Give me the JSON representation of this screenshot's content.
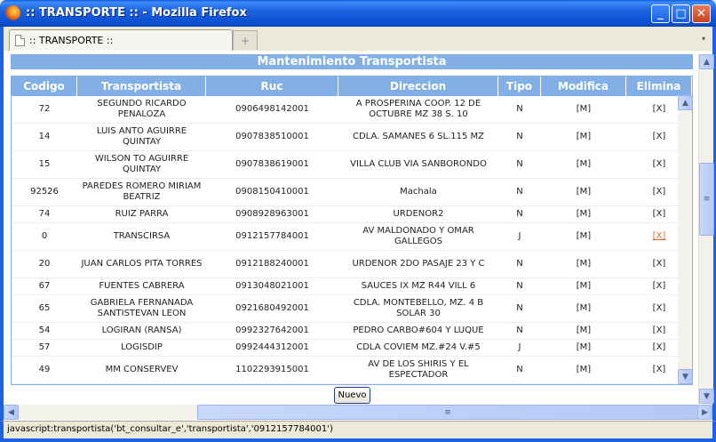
{
  "window": {
    "title": ":: TRANSPORTE :: - Mozilla Firefox",
    "minimize_glyph": "_",
    "maximize_glyph": "□",
    "close_glyph": "✕"
  },
  "tabs": {
    "active_label": ":: TRANSPORTE ::",
    "new_tab_glyph": "+",
    "list_glyph": "▾"
  },
  "panel": {
    "title": "Mantenimiento Transportista"
  },
  "table": {
    "headers": [
      "Codigo",
      "Transportista",
      "Ruc",
      "Direccion",
      "Tipo",
      "Modifica",
      "Elimina"
    ],
    "rows": [
      {
        "codigo": "72",
        "transportista": "SEGUNDO RICARDO PENALOZA",
        "ruc": "0906498142001",
        "direccion": "A PROSPERINA COOP. 12 DE OCTUBRE MZ 38 S. 10",
        "tipo": "N",
        "modifica": "[M]",
        "elimina": "[X]"
      },
      {
        "codigo": "14",
        "transportista": "LUIS ANTO AGUIRRE QUINTAY",
        "ruc": "0907838510001",
        "direccion": "CDLA. SAMANES 6 SL.115 MZ",
        "tipo": "N",
        "modifica": "[M]",
        "elimina": "[X]"
      },
      {
        "codigo": "15",
        "transportista": "WILSON TO AGUIRRE QUINTAY",
        "ruc": "0907838619001",
        "direccion": "VILLA CLUB VIA SANBORONDO",
        "tipo": "N",
        "modifica": "[M]",
        "elimina": "[X]"
      },
      {
        "codigo": "92526",
        "transportista": "PAREDES ROMERO MIRIAM BEATRIZ",
        "ruc": "0908150410001",
        "direccion": "Machala",
        "tipo": "N",
        "modifica": "[M]",
        "elimina": "[X]"
      },
      {
        "codigo": "74",
        "transportista": "RUIZ PARRA",
        "ruc": "0908928963001",
        "direccion": "URDENOR2",
        "tipo": "N",
        "modifica": "[M]",
        "elimina": "[X]"
      },
      {
        "codigo": "0",
        "transportista": "TRANSCIRSA",
        "ruc": "0912157784001",
        "direccion": "AV MALDONADO Y OMAR GALLEGOS",
        "tipo": "J",
        "modifica": "[M]",
        "elimina": "[X]",
        "elimina_hover": true
      },
      {
        "codigo": "20",
        "transportista": "JUAN CARLOS PITA TORRES",
        "ruc": "0912188240001",
        "direccion": "URDENOR 2DO PASAJE 23 Y C",
        "tipo": "N",
        "modifica": "[M]",
        "elimina": "[X]"
      },
      {
        "codigo": "67",
        "transportista": "FUENTES CABRERA",
        "ruc": "0913048021001",
        "direccion": "SAUCES IX MZ R44 VILL 6",
        "tipo": "N",
        "modifica": "[M]",
        "elimina": "[X]"
      },
      {
        "codigo": "65",
        "transportista": "GABRIELA FERNANADA SANTISTEVAN LEON",
        "ruc": "0921680492001",
        "direccion": "CDLA. MONTEBELLO, MZ. 4 B SOLAR 30",
        "tipo": "N",
        "modifica": "[M]",
        "elimina": "[X]"
      },
      {
        "codigo": "54",
        "transportista": "LOGIRAN (RANSA)",
        "ruc": "0992327642001",
        "direccion": "PEDRO CARBO#604 Y LUQUE",
        "tipo": "N",
        "modifica": "[M]",
        "elimina": "[X]"
      },
      {
        "codigo": "57",
        "transportista": "LOGISDIP",
        "ruc": "0992444312001",
        "direccion": "CDLA COVIEM MZ.#24 V.#5",
        "tipo": "J",
        "modifica": "[M]",
        "elimina": "[X]"
      },
      {
        "codigo": "49",
        "transportista": "MM CONSERVEV",
        "ruc": "1102293915001",
        "direccion": "AV DE LOS SHIRIS Y EL ESPECTADOR",
        "tipo": "N",
        "modifica": "[M]",
        "elimina": "[X]"
      }
    ]
  },
  "buttons": {
    "nuevo": "Nuevo"
  },
  "scroll": {
    "up": "▲",
    "down": "▼",
    "left": "◀",
    "right": "▶",
    "grip": "≡"
  },
  "statusbar": {
    "text": "javascript:transportista('bt_consultar_e','transportista','0912157784001')"
  }
}
